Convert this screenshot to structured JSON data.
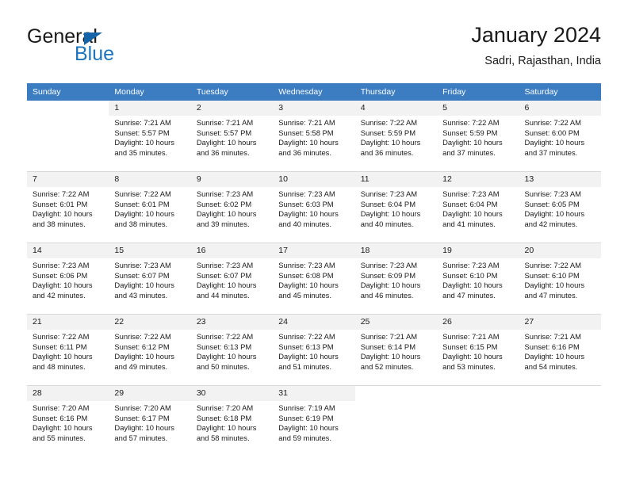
{
  "brand": {
    "name_top": "General",
    "name_bottom": "Blue",
    "triangle_icon": "brand-triangle-icon",
    "accent_color": "#1b74bd"
  },
  "header": {
    "title": "January 2024",
    "subtitle": "Sadri, Rajasthan, India"
  },
  "colors": {
    "header_row_bg": "#3b7dc0",
    "daynum_bg": "#f2f2f2",
    "text": "#1a1a1a",
    "row_separator": "#d9d9d9"
  },
  "weekdays": [
    "Sunday",
    "Monday",
    "Tuesday",
    "Wednesday",
    "Thursday",
    "Friday",
    "Saturday"
  ],
  "weeks": [
    [
      {
        "day": "",
        "empty": true,
        "sunrise": "",
        "sunset": "",
        "daylight": "",
        "daylight2": ""
      },
      {
        "day": "1",
        "sunrise": "Sunrise: 7:21 AM",
        "sunset": "Sunset: 5:57 PM",
        "daylight": "Daylight: 10 hours",
        "daylight2": "and 35 minutes."
      },
      {
        "day": "2",
        "sunrise": "Sunrise: 7:21 AM",
        "sunset": "Sunset: 5:57 PM",
        "daylight": "Daylight: 10 hours",
        "daylight2": "and 36 minutes."
      },
      {
        "day": "3",
        "sunrise": "Sunrise: 7:21 AM",
        "sunset": "Sunset: 5:58 PM",
        "daylight": "Daylight: 10 hours",
        "daylight2": "and 36 minutes."
      },
      {
        "day": "4",
        "sunrise": "Sunrise: 7:22 AM",
        "sunset": "Sunset: 5:59 PM",
        "daylight": "Daylight: 10 hours",
        "daylight2": "and 36 minutes."
      },
      {
        "day": "5",
        "sunrise": "Sunrise: 7:22 AM",
        "sunset": "Sunset: 5:59 PM",
        "daylight": "Daylight: 10 hours",
        "daylight2": "and 37 minutes."
      },
      {
        "day": "6",
        "sunrise": "Sunrise: 7:22 AM",
        "sunset": "Sunset: 6:00 PM",
        "daylight": "Daylight: 10 hours",
        "daylight2": "and 37 minutes."
      }
    ],
    [
      {
        "day": "7",
        "sunrise": "Sunrise: 7:22 AM",
        "sunset": "Sunset: 6:01 PM",
        "daylight": "Daylight: 10 hours",
        "daylight2": "and 38 minutes."
      },
      {
        "day": "8",
        "sunrise": "Sunrise: 7:22 AM",
        "sunset": "Sunset: 6:01 PM",
        "daylight": "Daylight: 10 hours",
        "daylight2": "and 38 minutes."
      },
      {
        "day": "9",
        "sunrise": "Sunrise: 7:23 AM",
        "sunset": "Sunset: 6:02 PM",
        "daylight": "Daylight: 10 hours",
        "daylight2": "and 39 minutes."
      },
      {
        "day": "10",
        "sunrise": "Sunrise: 7:23 AM",
        "sunset": "Sunset: 6:03 PM",
        "daylight": "Daylight: 10 hours",
        "daylight2": "and 40 minutes."
      },
      {
        "day": "11",
        "sunrise": "Sunrise: 7:23 AM",
        "sunset": "Sunset: 6:04 PM",
        "daylight": "Daylight: 10 hours",
        "daylight2": "and 40 minutes."
      },
      {
        "day": "12",
        "sunrise": "Sunrise: 7:23 AM",
        "sunset": "Sunset: 6:04 PM",
        "daylight": "Daylight: 10 hours",
        "daylight2": "and 41 minutes."
      },
      {
        "day": "13",
        "sunrise": "Sunrise: 7:23 AM",
        "sunset": "Sunset: 6:05 PM",
        "daylight": "Daylight: 10 hours",
        "daylight2": "and 42 minutes."
      }
    ],
    [
      {
        "day": "14",
        "sunrise": "Sunrise: 7:23 AM",
        "sunset": "Sunset: 6:06 PM",
        "daylight": "Daylight: 10 hours",
        "daylight2": "and 42 minutes."
      },
      {
        "day": "15",
        "sunrise": "Sunrise: 7:23 AM",
        "sunset": "Sunset: 6:07 PM",
        "daylight": "Daylight: 10 hours",
        "daylight2": "and 43 minutes."
      },
      {
        "day": "16",
        "sunrise": "Sunrise: 7:23 AM",
        "sunset": "Sunset: 6:07 PM",
        "daylight": "Daylight: 10 hours",
        "daylight2": "and 44 minutes."
      },
      {
        "day": "17",
        "sunrise": "Sunrise: 7:23 AM",
        "sunset": "Sunset: 6:08 PM",
        "daylight": "Daylight: 10 hours",
        "daylight2": "and 45 minutes."
      },
      {
        "day": "18",
        "sunrise": "Sunrise: 7:23 AM",
        "sunset": "Sunset: 6:09 PM",
        "daylight": "Daylight: 10 hours",
        "daylight2": "and 46 minutes."
      },
      {
        "day": "19",
        "sunrise": "Sunrise: 7:23 AM",
        "sunset": "Sunset: 6:10 PM",
        "daylight": "Daylight: 10 hours",
        "daylight2": "and 47 minutes."
      },
      {
        "day": "20",
        "sunrise": "Sunrise: 7:22 AM",
        "sunset": "Sunset: 6:10 PM",
        "daylight": "Daylight: 10 hours",
        "daylight2": "and 47 minutes."
      }
    ],
    [
      {
        "day": "21",
        "sunrise": "Sunrise: 7:22 AM",
        "sunset": "Sunset: 6:11 PM",
        "daylight": "Daylight: 10 hours",
        "daylight2": "and 48 minutes."
      },
      {
        "day": "22",
        "sunrise": "Sunrise: 7:22 AM",
        "sunset": "Sunset: 6:12 PM",
        "daylight": "Daylight: 10 hours",
        "daylight2": "and 49 minutes."
      },
      {
        "day": "23",
        "sunrise": "Sunrise: 7:22 AM",
        "sunset": "Sunset: 6:13 PM",
        "daylight": "Daylight: 10 hours",
        "daylight2": "and 50 minutes."
      },
      {
        "day": "24",
        "sunrise": "Sunrise: 7:22 AM",
        "sunset": "Sunset: 6:13 PM",
        "daylight": "Daylight: 10 hours",
        "daylight2": "and 51 minutes."
      },
      {
        "day": "25",
        "sunrise": "Sunrise: 7:21 AM",
        "sunset": "Sunset: 6:14 PM",
        "daylight": "Daylight: 10 hours",
        "daylight2": "and 52 minutes."
      },
      {
        "day": "26",
        "sunrise": "Sunrise: 7:21 AM",
        "sunset": "Sunset: 6:15 PM",
        "daylight": "Daylight: 10 hours",
        "daylight2": "and 53 minutes."
      },
      {
        "day": "27",
        "sunrise": "Sunrise: 7:21 AM",
        "sunset": "Sunset: 6:16 PM",
        "daylight": "Daylight: 10 hours",
        "daylight2": "and 54 minutes."
      }
    ],
    [
      {
        "day": "28",
        "sunrise": "Sunrise: 7:20 AM",
        "sunset": "Sunset: 6:16 PM",
        "daylight": "Daylight: 10 hours",
        "daylight2": "and 55 minutes."
      },
      {
        "day": "29",
        "sunrise": "Sunrise: 7:20 AM",
        "sunset": "Sunset: 6:17 PM",
        "daylight": "Daylight: 10 hours",
        "daylight2": "and 57 minutes."
      },
      {
        "day": "30",
        "sunrise": "Sunrise: 7:20 AM",
        "sunset": "Sunset: 6:18 PM",
        "daylight": "Daylight: 10 hours",
        "daylight2": "and 58 minutes."
      },
      {
        "day": "31",
        "sunrise": "Sunrise: 7:19 AM",
        "sunset": "Sunset: 6:19 PM",
        "daylight": "Daylight: 10 hours",
        "daylight2": "and 59 minutes."
      },
      {
        "day": "",
        "empty": true,
        "sunrise": "",
        "sunset": "",
        "daylight": "",
        "daylight2": ""
      },
      {
        "day": "",
        "empty": true,
        "sunrise": "",
        "sunset": "",
        "daylight": "",
        "daylight2": ""
      },
      {
        "day": "",
        "empty": true,
        "sunrise": "",
        "sunset": "",
        "daylight": "",
        "daylight2": ""
      }
    ]
  ]
}
